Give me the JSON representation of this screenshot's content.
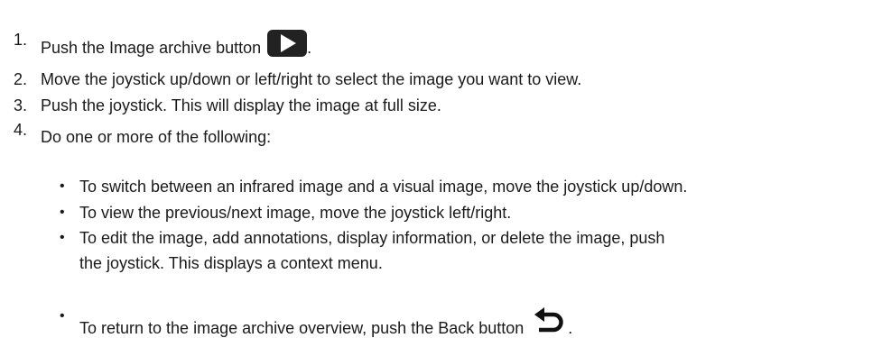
{
  "steps": [
    {
      "num": "1.",
      "text": "Push the Image archive button",
      "suffix": "."
    },
    {
      "num": "2.",
      "text": "Move the joystick up/down or left/right to select the image you want to view."
    },
    {
      "num": "3.",
      "text": "Push the joystick. This will display the image at full size."
    },
    {
      "num": "4.",
      "text": "Do one or more of the following:"
    }
  ],
  "bullets": [
    {
      "text": "To switch between an infrared image and a visual image, move the joystick up/down."
    },
    {
      "text": "To view the previous/next image, move the joystick left/right."
    },
    {
      "line1": "To edit the image, add annotations, display information, or delete the image, push",
      "line2": "the joystick. This displays a context menu."
    },
    {
      "text": "To return to the image archive overview, push the Back button",
      "suffix": "."
    }
  ],
  "bullet_char": "•",
  "icons": {
    "image_archive_button": "play-icon",
    "back_button": "back-arrow-icon"
  }
}
